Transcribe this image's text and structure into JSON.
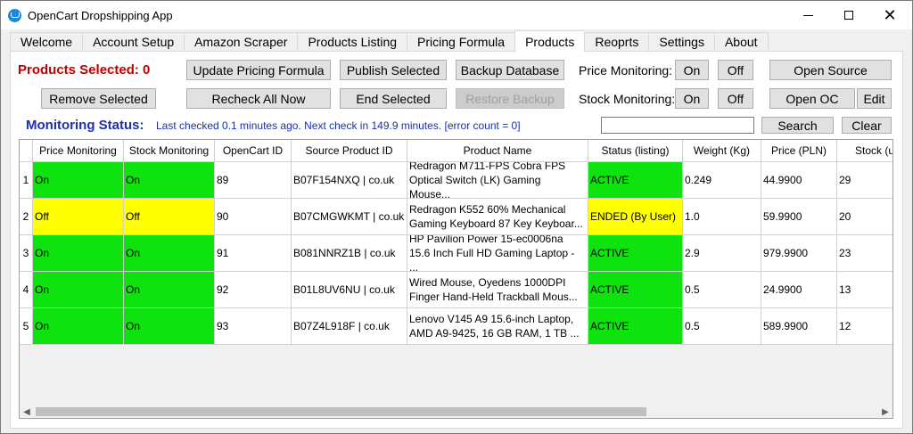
{
  "window": {
    "title": "OpenCart Dropshipping App"
  },
  "tabs": [
    {
      "label": "Welcome"
    },
    {
      "label": "Account Setup"
    },
    {
      "label": "Amazon Scraper"
    },
    {
      "label": "Products Listing"
    },
    {
      "label": "Pricing Formula"
    },
    {
      "label": "Products"
    },
    {
      "label": "Reoprts"
    },
    {
      "label": "Settings"
    },
    {
      "label": "About"
    }
  ],
  "toolbar": {
    "products_selected": "Products Selected: 0",
    "update_pricing": "Update Pricing Formula",
    "publish_selected": "Publish Selected",
    "backup_database": "Backup Database",
    "price_monitoring_label": "Price Monitoring:",
    "price_on": "On",
    "price_off": "Off",
    "open_source": "Open Source",
    "remove_selected": "Remove Selected",
    "recheck_all": "Recheck All Now",
    "end_selected": "End Selected",
    "restore_backup": "Restore Backup",
    "stock_monitoring_label": "Stock Monitoring:",
    "stock_on": "On",
    "stock_off": "Off",
    "open_oc": "Open OC",
    "edit": "Edit"
  },
  "status": {
    "label": "Monitoring Status:",
    "text": "Last checked 0.1 minutes ago. Next check in 149.9 minutes. [error count = 0]"
  },
  "search": {
    "value": "",
    "search_label": "Search",
    "clear_label": "Clear"
  },
  "table": {
    "columns": [
      "Price Monitoring",
      "Stock Monitoring",
      "OpenCart ID",
      "Source Product ID",
      "Product Name",
      "Status (listing)",
      "Weight (Kg)",
      "Price (PLN)",
      "Stock (u"
    ],
    "rows": [
      {
        "num": "1",
        "price_mon": "On",
        "stock_mon": "On",
        "oc_id": "89",
        "source_id": "B07F154NXQ | co.uk",
        "name": "Redragon M711-FPS Cobra FPS Optical Switch (LK) Gaming Mouse...",
        "status": "ACTIVE",
        "weight": "0.249",
        "price": "44.9900",
        "stock": "29",
        "colors": {
          "price": "#0fe30f",
          "stock": "#0fe30f",
          "status": "#0fe30f"
        }
      },
      {
        "num": "2",
        "price_mon": "Off",
        "stock_mon": "Off",
        "oc_id": "90",
        "source_id": "B07CMGWKMT | co.uk",
        "name": "Redragon K552 60% Mechanical Gaming Keyboard 87 Key Keyboar...",
        "status": "ENDED (By User)",
        "weight": "1.0",
        "price": "59.9900",
        "stock": "20",
        "colors": {
          "price": "#ffff00",
          "stock": "#ffff00",
          "status": "#ffff00"
        }
      },
      {
        "num": "3",
        "price_mon": "On",
        "stock_mon": "On",
        "oc_id": "91",
        "source_id": "B081NNRZ1B | co.uk",
        "name": "HP Pavilion Power 15-ec0006na 15.6 Inch Full HD Gaming Laptop - ...",
        "status": "ACTIVE",
        "weight": "2.9",
        "price": "979.9900",
        "stock": "23",
        "colors": {
          "price": "#0fe30f",
          "stock": "#0fe30f",
          "status": "#0fe30f"
        }
      },
      {
        "num": "4",
        "price_mon": "On",
        "stock_mon": "On",
        "oc_id": "92",
        "source_id": "B01L8UV6NU | co.uk",
        "name": "Wired Mouse, Oyedens 1000DPI Finger Hand-Held Trackball Mous...",
        "status": "ACTIVE",
        "weight": "0.5",
        "price": "24.9900",
        "stock": "13",
        "colors": {
          "price": "#0fe30f",
          "stock": "#0fe30f",
          "status": "#0fe30f"
        }
      },
      {
        "num": "5",
        "price_mon": "On",
        "stock_mon": "On",
        "oc_id": "93",
        "source_id": "B07Z4L918F | co.uk",
        "name": "Lenovo V145 A9 15.6-inch Laptop, AMD A9-9425, 16 GB RAM, 1 TB ...",
        "status": "ACTIVE",
        "weight": "0.5",
        "price": "589.9900",
        "stock": "12",
        "colors": {
          "price": "#0fe30f",
          "stock": "#0fe30f",
          "status": "#0fe30f"
        }
      }
    ]
  }
}
